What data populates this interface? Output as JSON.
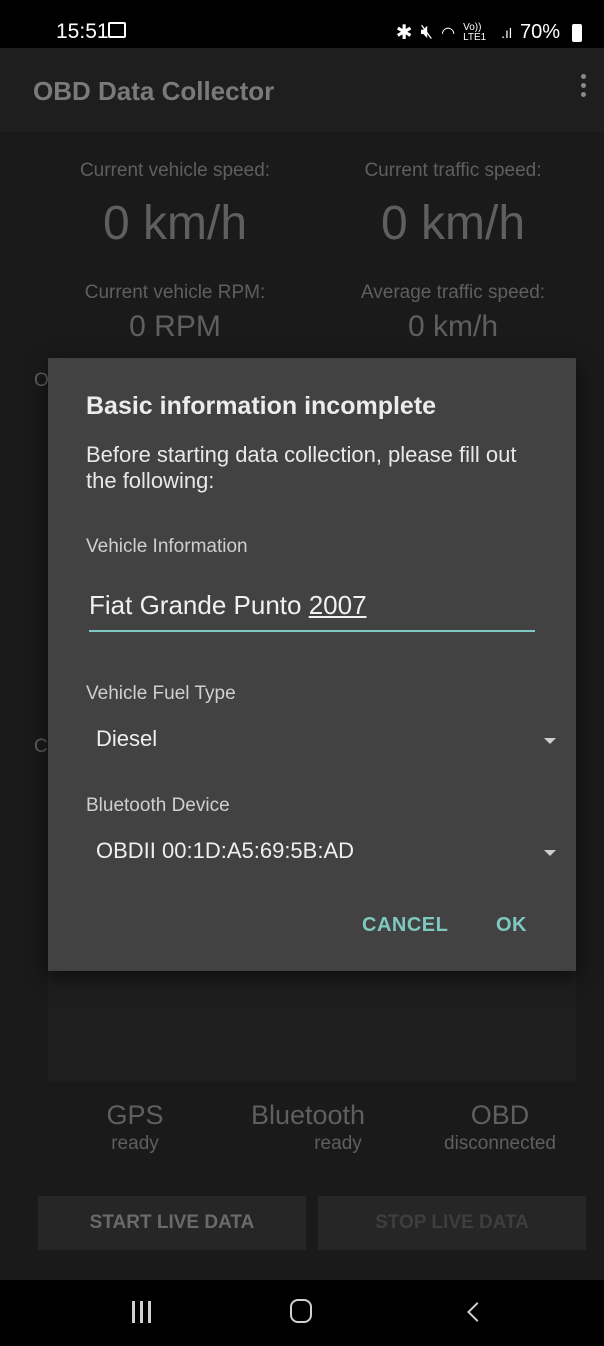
{
  "status_bar": {
    "time": "15:51",
    "signal_text": "Vo)) LTE1",
    "battery": "70%"
  },
  "app_bar": {
    "title": "OBD Data Collector"
  },
  "dashboard": {
    "vehicle_speed_label": "Current vehicle speed:",
    "vehicle_speed_value": "0 km/h",
    "traffic_speed_label": "Current traffic speed:",
    "traffic_speed_value": "0 km/h",
    "vehicle_rpm_label": "Current vehicle RPM:",
    "vehicle_rpm_value": "0 RPM",
    "avg_traffic_label": "Average traffic speed:",
    "avg_traffic_value": "0 km/h",
    "partial_letter_1": "O",
    "partial_letter_2": "C"
  },
  "status_indicators": [
    {
      "name": "GPS",
      "state": "ready"
    },
    {
      "name": "Bluetooth",
      "state": "ready"
    },
    {
      "name": "OBD",
      "state": "disconnected"
    }
  ],
  "buttons": {
    "start_live": "START LIVE DATA",
    "stop_live": "STOP LIVE DATA"
  },
  "dialog": {
    "title": "Basic information incomplete",
    "message": "Before starting data collection, please fill out the following:",
    "vehicle_info_label": "Vehicle Information",
    "vehicle_info_value_main": "Fiat Grande Punto ",
    "vehicle_info_value_year": "2007",
    "fuel_type_label": "Vehicle Fuel Type",
    "fuel_type_value": "Diesel",
    "bluetooth_label": "Bluetooth Device",
    "bluetooth_value": "OBDII 00:1D:A5:69:5B:AD",
    "cancel": "CANCEL",
    "ok": "OK"
  },
  "colors": {
    "accent": "#7ec8c0",
    "dialog_bg": "#424242",
    "screen_bg": "#1a1a1a"
  }
}
